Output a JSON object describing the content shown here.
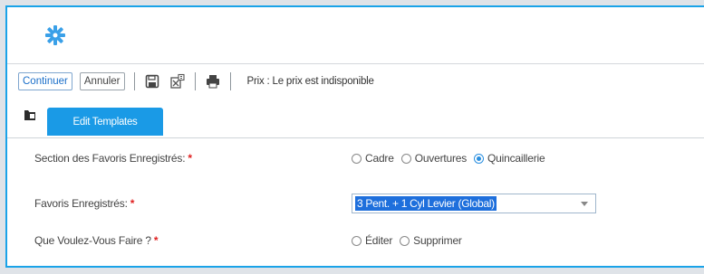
{
  "toolbar": {
    "continue_label": "Continuer",
    "cancel_label": "Annuler",
    "price_text": "Prix : Le prix est indisponible"
  },
  "tabs": [
    {
      "label": "Edit Templates",
      "active": true
    }
  ],
  "form": {
    "section": {
      "label": "Section des Favoris Enregistrés:",
      "required_mark": "*",
      "options": [
        "Cadre",
        "Ouvertures",
        "Quincaillerie"
      ],
      "selected": "Quincaillerie"
    },
    "favorites": {
      "label": "Favoris Enregistrés:",
      "required_mark": "*",
      "selected_value": "3 Pent. + 1 Cyl Levier (Global)"
    },
    "action": {
      "label": "Que Voulez-Vous Faire ?",
      "required_mark": "*",
      "options": [
        "Éditer",
        "Supprimer"
      ],
      "selected": null
    }
  },
  "icons": {
    "gear": "gear-icon",
    "save": "save-icon",
    "export": "export-icon",
    "print": "print-icon",
    "folder": "folder-icon"
  },
  "colors": {
    "accent": "#1a9ae6",
    "frame_border": "#1aa3e8",
    "required": "#e02020",
    "selection": "#1e6fdc"
  }
}
